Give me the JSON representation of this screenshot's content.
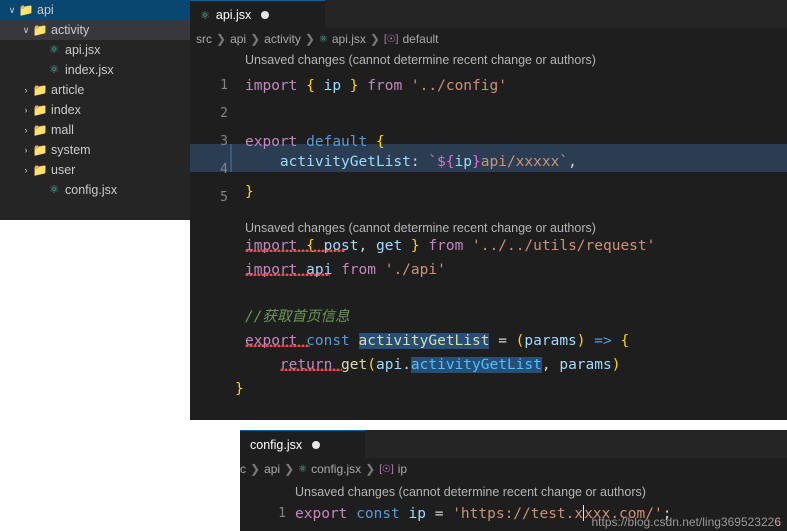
{
  "explorer": {
    "items": [
      {
        "indent": 0,
        "chevron": "∨",
        "icon": "folder",
        "label": "api",
        "state": "active"
      },
      {
        "indent": 1,
        "chevron": "∨",
        "icon": "folder",
        "label": "activity",
        "state": "selected"
      },
      {
        "indent": 2,
        "chevron": "",
        "icon": "jsx",
        "label": "api.jsx",
        "state": "none"
      },
      {
        "indent": 2,
        "chevron": "",
        "icon": "jsx",
        "label": "index.jsx",
        "state": "none"
      },
      {
        "indent": 1,
        "chevron": "›",
        "icon": "folder",
        "label": "article",
        "state": "none"
      },
      {
        "indent": 1,
        "chevron": "›",
        "icon": "folder",
        "label": "index",
        "state": "none"
      },
      {
        "indent": 1,
        "chevron": "›",
        "icon": "folder",
        "label": "mall",
        "state": "none"
      },
      {
        "indent": 1,
        "chevron": "›",
        "icon": "folder",
        "label": "system",
        "state": "none"
      },
      {
        "indent": 1,
        "chevron": "›",
        "icon": "folder",
        "label": "user",
        "state": "none"
      },
      {
        "indent": 1,
        "chevron": "",
        "icon": "jsx",
        "label": "config.jsx",
        "state": "none"
      }
    ]
  },
  "editor": {
    "tab": {
      "label": "api.jsx",
      "dirty_dot": "●"
    },
    "breadcrumb": [
      "src",
      "api",
      "activity",
      "api.jsx",
      "default"
    ],
    "warning": "Unsaved changes (cannot determine recent change or authors)",
    "line_numbers": [
      "1",
      "2",
      "3",
      "4",
      "5"
    ],
    "lines": [
      {
        "n": "1",
        "text": "import { ip } from '../config'"
      },
      {
        "n": "2",
        "text": ""
      },
      {
        "n": "3",
        "text": "export default {"
      },
      {
        "n": "4",
        "text": "    activityGetList: `${ip}api/xxxxx`,"
      },
      {
        "n": "5",
        "text": "}"
      }
    ]
  },
  "second": {
    "warning": "Unsaved changes (cannot determine recent change or authors)",
    "lines": [
      "import { post, get } from '../../utils/request'",
      "import api from './api'",
      "",
      "//获取首页信息",
      "export const activityGetList = (params) => {",
      "    return get(api.activityGetList, params)",
      "}"
    ],
    "comment": "//获取首页信息",
    "highlighted_symbol": "activityGetList"
  },
  "lower": {
    "tab": {
      "label": "config.jsx",
      "dirty_dot": "●"
    },
    "breadcrumb": [
      "c",
      "api",
      "config.jsx",
      "ip"
    ],
    "warning": "Unsaved changes (cannot determine recent change or authors)",
    "line_number": "1",
    "code": "export const ip = 'https://test.xxxx.com/';",
    "code_parts": {
      "kw": "export",
      "kw2": "const",
      "id": "ip",
      "eq": "=",
      "str_a": "'https://test.x",
      "str_b": "xxx.com/'",
      "semi": ";"
    }
  },
  "watermark": {
    "text": "https://blog.csdn.net/ling36952322",
    "tail": "6"
  },
  "colors": {
    "bg": "#1e1e1e",
    "sidebar_bg": "#252526",
    "active_row": "#094771",
    "selected_row": "#37373d",
    "selection_blue": "#264f78",
    "line_highlight": "#2a3d52",
    "keyword": "#569cd6",
    "keyword2": "#c586c0",
    "string": "#ce9178",
    "comment": "#6a9955",
    "identifier": "#9cdcfe",
    "function": "#dcdcaa",
    "brace": "#ffd700",
    "error": "#f14c4c",
    "folder": "#dcb67a",
    "jsx_icon": "#4ec9b0"
  }
}
